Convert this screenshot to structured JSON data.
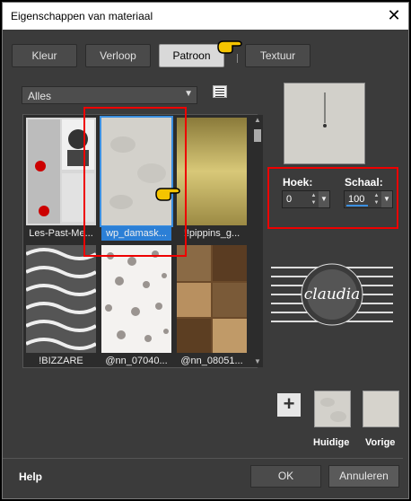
{
  "window": {
    "title": "Eigenschappen van materiaal"
  },
  "tabs": [
    "Kleur",
    "Verloop",
    "Patroon",
    "Textuur"
  ],
  "active_tab": "Patroon",
  "category_select": {
    "value": "Alles"
  },
  "patterns": [
    {
      "name": "Les-Past-Me...",
      "selected": false
    },
    {
      "name": "wp_damask...",
      "selected": true
    },
    {
      "name": "!!pippins_g...",
      "selected": false
    },
    {
      "name": "!BIZZARE",
      "selected": false
    },
    {
      "name": "@nn_07040...",
      "selected": false
    },
    {
      "name": "@nn_08051...",
      "selected": false
    }
  ],
  "angle": {
    "label": "Hoek:",
    "value": "0"
  },
  "scale": {
    "label": "Schaal:",
    "value": "100"
  },
  "watermark": {
    "text": "claudia"
  },
  "current": {
    "label": "Huidige"
  },
  "previous": {
    "label": "Vorige"
  },
  "footer": {
    "help": "Help",
    "ok": "OK",
    "cancel": "Annuleren"
  },
  "colors": {
    "dialog_bg": "#3b3b3b",
    "highlight": "#e00000",
    "selection": "#2b7fd6",
    "pattern_base": "#d2d0ca"
  }
}
